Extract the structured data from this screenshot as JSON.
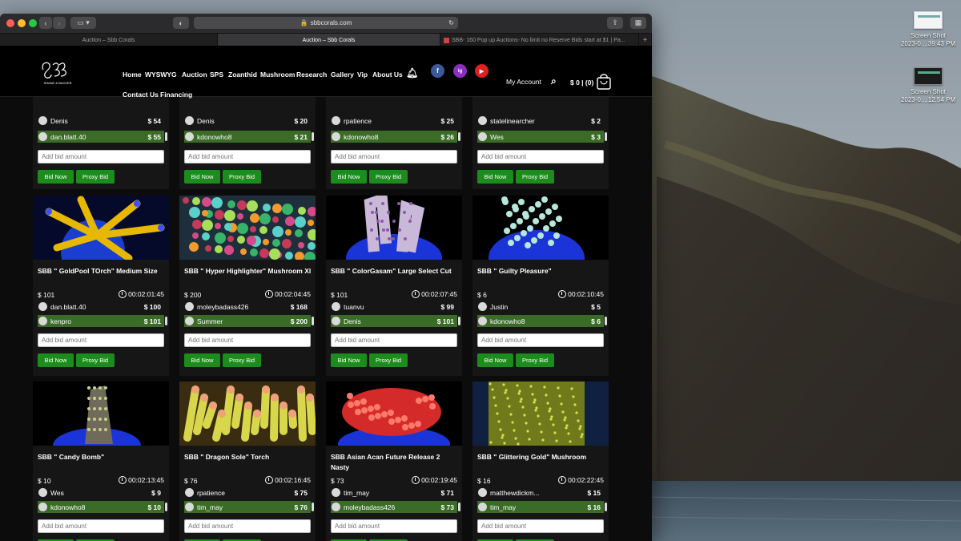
{
  "browser": {
    "url": "sbbcorals.com",
    "tabs": [
      {
        "label": "Auction – Sbb Corals",
        "active": false
      },
      {
        "label": "Auction – Sbb Corals",
        "active": true
      },
      {
        "label": "SBB- 160 Pop up Auctions- No limit no Reserve Bids start at $1 | Pa...",
        "active": false
      }
    ],
    "new_tab": "+"
  },
  "desktop": {
    "icons": [
      {
        "line1": "Screen Shot",
        "line2": "2023-0....39.43 PM"
      },
      {
        "line1": "Screen Shot",
        "line2": "2023-0....12.54 PM"
      }
    ]
  },
  "header": {
    "logo_text": "SHANE & BACKER",
    "nav": [
      "Home",
      "WYSWYG",
      "Auction",
      "SPS",
      "Zoanthid",
      "Mushroom",
      "Research",
      "Gallery",
      "Vip",
      "About Us"
    ],
    "nav2": [
      "Contact Us",
      "Financing"
    ],
    "social": [
      "f",
      "ig",
      "▶"
    ],
    "account": "My Account",
    "cart": "$ 0 | (0)"
  },
  "labels": {
    "placeholder": "Add bid amount",
    "bid_now": "Bid Now",
    "proxy_bid": "Proxy Bid"
  },
  "top_partial": [
    {
      "prev_user": "Denis",
      "prev_amt": "$ 54",
      "top_user": "dan.blatt.40",
      "top_amt": "$ 55"
    },
    {
      "prev_user": "Denis",
      "prev_amt": "$ 20",
      "top_user": "kdonowho8",
      "top_amt": "$ 21"
    },
    {
      "prev_user": "rpatience",
      "prev_amt": "$ 25",
      "top_user": "kdonowho8",
      "top_amt": "$ 26"
    },
    {
      "prev_user": "statelinearcher",
      "prev_amt": "$ 2",
      "top_user": "Wes",
      "top_amt": "$ 3"
    }
  ],
  "items": [
    {
      "title": "SBB \" GoldPool TOrch\" Medium Size",
      "price": "$ 101",
      "timer": "00:02:01:45",
      "prev_user": "dan.blatt.40",
      "prev_amt": "$ 100",
      "top_user": "kenpro",
      "top_amt": "$ 101"
    },
    {
      "title": "SBB \" Hyper Highlighter\" Mushroom Xl",
      "price": "$ 200",
      "timer": "00:02:04:45",
      "prev_user": "moleybadass426",
      "prev_amt": "$ 168",
      "top_user": "Summer",
      "top_amt": "$ 200"
    },
    {
      "title": "SBB \" ColorGasam\" Large Select Cut",
      "price": "$ 101",
      "timer": "00:02:07:45",
      "prev_user": "tuanvu",
      "prev_amt": "$ 99",
      "top_user": "Denis",
      "top_amt": "$ 101"
    },
    {
      "title": "SBB \" Guilty Pleasure\"",
      "price": "$ 6",
      "timer": "00:02:10:45",
      "prev_user": "Justin",
      "prev_amt": "$ 5",
      "top_user": "kdonowho8",
      "top_amt": "$ 6"
    },
    {
      "title": "SBB \" Candy Bomb\"",
      "price": "$ 10",
      "timer": "00:02:13:45",
      "prev_user": "Wes",
      "prev_amt": "$ 9",
      "top_user": "kdonowho8",
      "top_amt": "$ 10"
    },
    {
      "title": "SBB \" Dragon Sole\" Torch",
      "price": "$ 76",
      "timer": "00:02:16:45",
      "prev_user": "rpatience",
      "prev_amt": "$ 75",
      "top_user": "tim_may",
      "top_amt": "$ 76"
    },
    {
      "title": "SBB Asian Acan Future Release 2 Nasty",
      "price": "$ 73",
      "timer": "00:02:19:45",
      "prev_user": "tim_may",
      "prev_amt": "$ 71",
      "top_user": "moleybadass426",
      "top_amt": "$ 73"
    },
    {
      "title": "SBB \" Glittering Gold\" Mushroom",
      "price": "$ 16",
      "timer": "00:02:22:45",
      "prev_user": "matthewdickm...",
      "prev_amt": "$ 15",
      "top_user": "tim_may",
      "top_amt": "$ 16"
    }
  ],
  "colors": {
    "accent_green": "#1c8c1c",
    "top_bid_row": "#3a6b27",
    "background": "#0c0c0c"
  }
}
